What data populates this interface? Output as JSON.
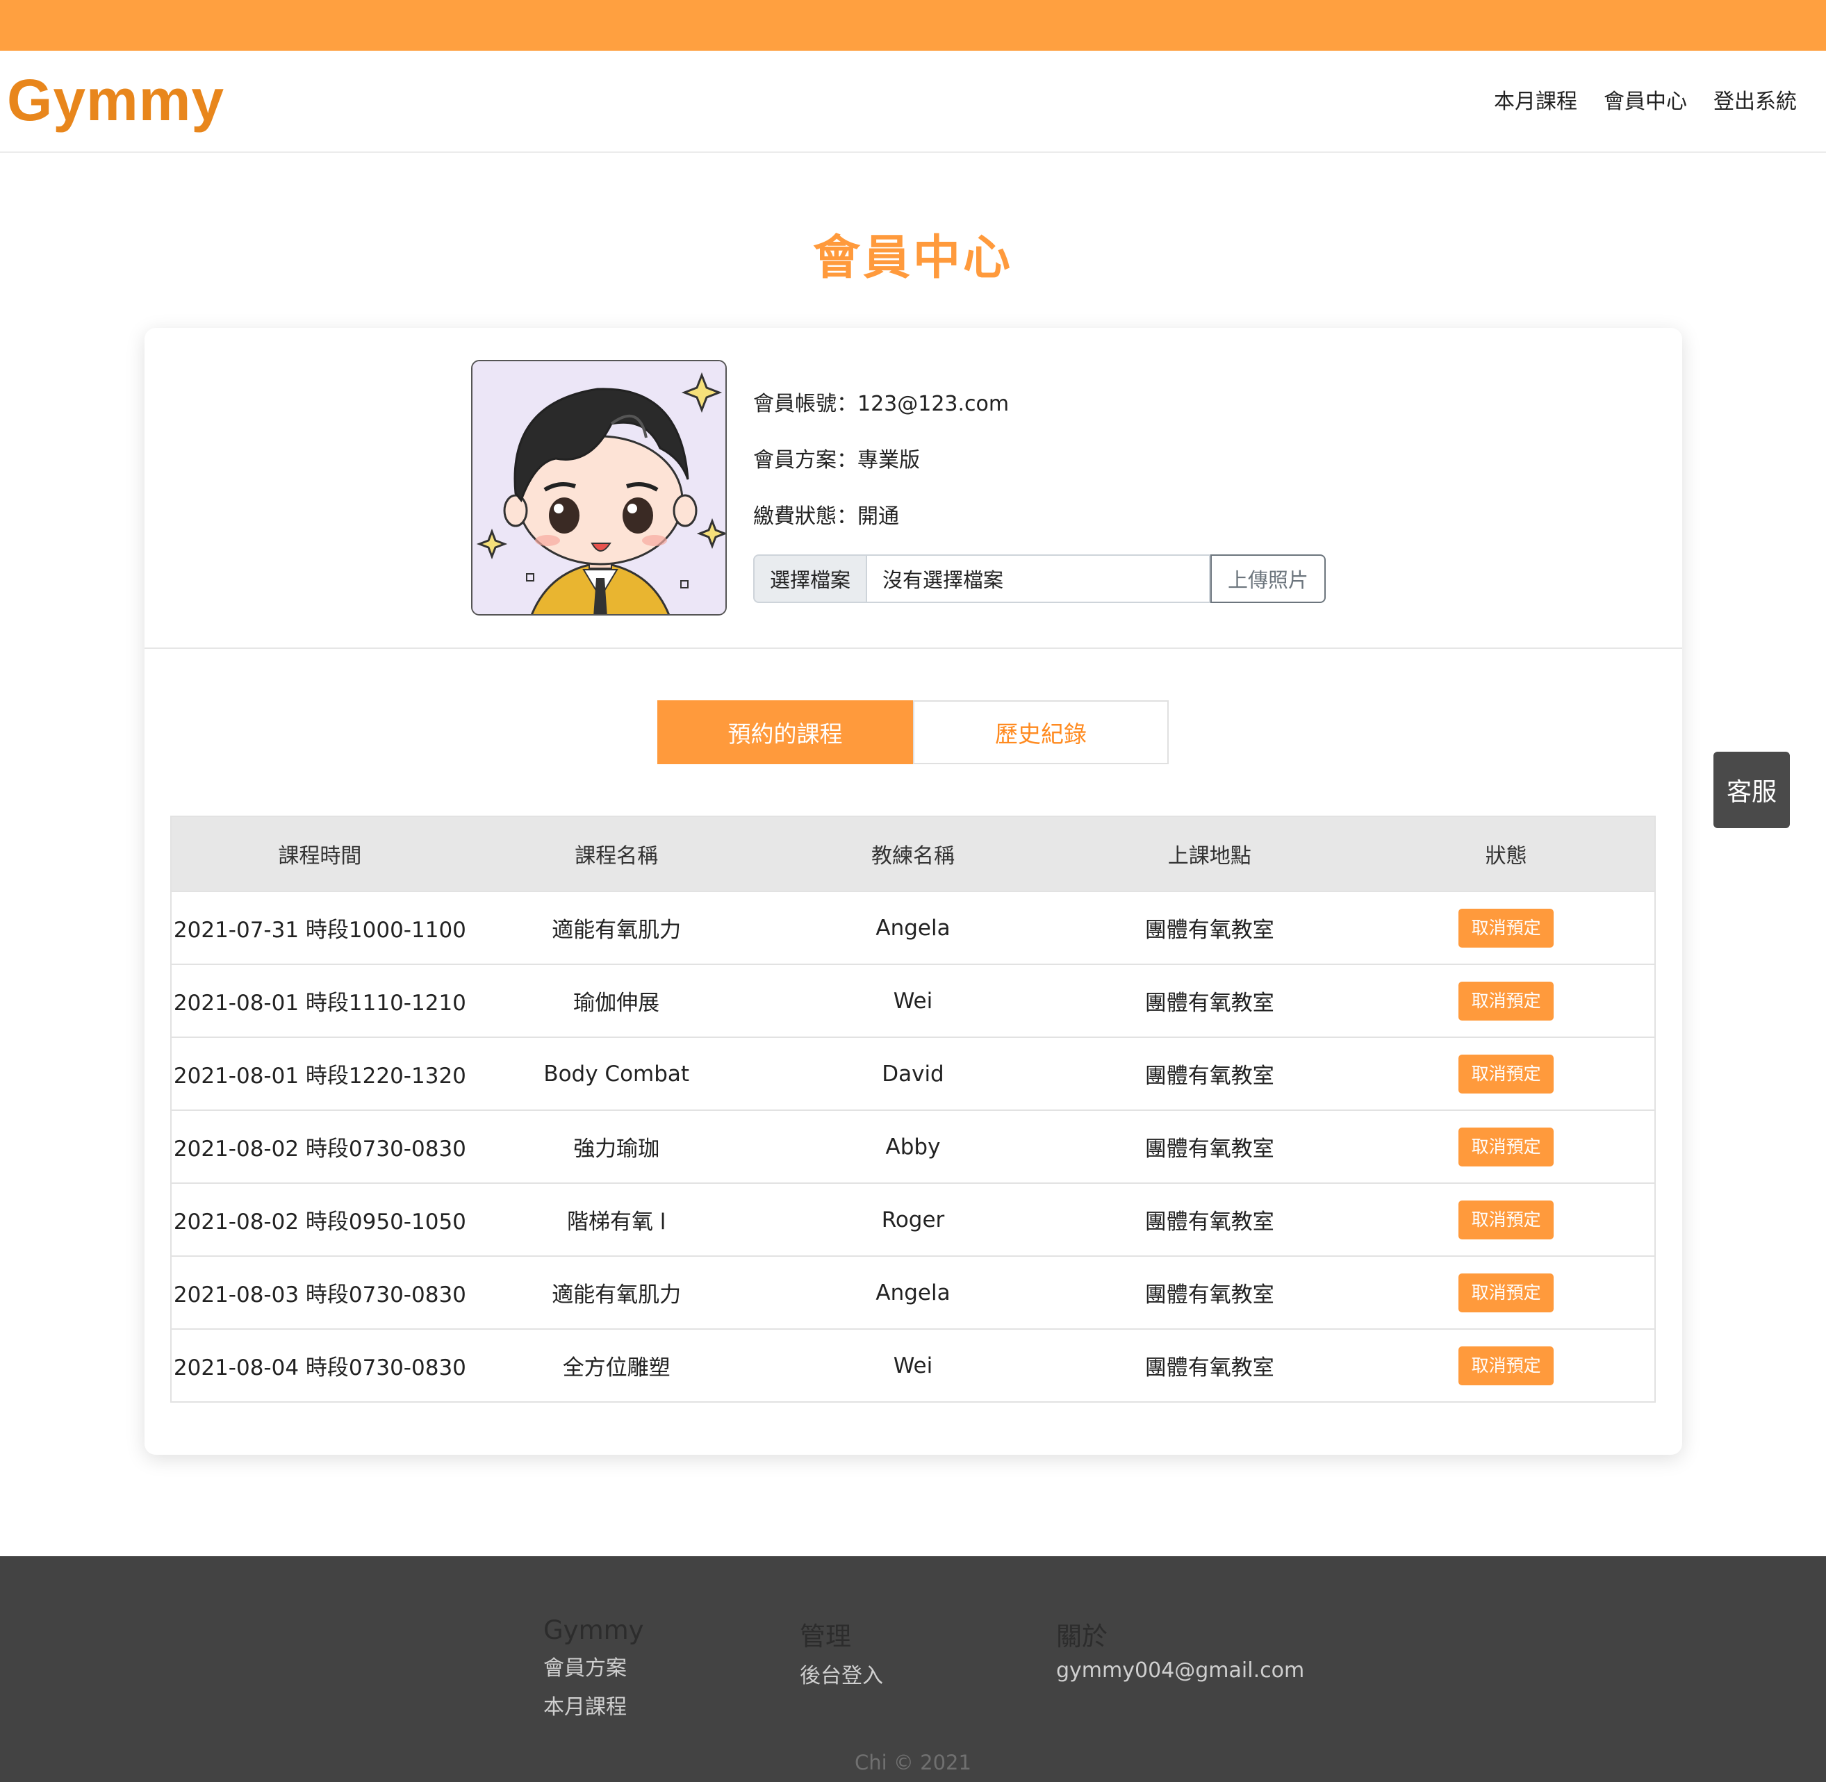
{
  "brand": "Gymmy",
  "nav": {
    "courses": "本月課程",
    "member": "會員中心",
    "logout": "登出系統"
  },
  "page_title": "會員中心",
  "profile": {
    "account_label": "會員帳號：",
    "account_value": "123@123.com",
    "plan_label": "會員方案：",
    "plan_value": "專業版",
    "payment_label": "繳費狀態：",
    "payment_value": "開通",
    "file_choose_label": "選擇檔案",
    "file_name": "沒有選擇檔案",
    "upload_label": "上傳照片"
  },
  "tabs": {
    "booked": "預約的課程",
    "history": "歷史紀錄"
  },
  "table": {
    "headers": [
      "課程時間",
      "課程名稱",
      "教練名稱",
      "上課地點",
      "狀態"
    ],
    "rows": [
      {
        "time": "2021-07-31 時段1000-1100",
        "course": "適能有氧肌力",
        "coach": "Angela",
        "location": "團體有氧教室",
        "action": "取消預定"
      },
      {
        "time": "2021-08-01 時段1110-1210",
        "course": "瑜伽伸展",
        "coach": "Wei",
        "location": "團體有氧教室",
        "action": "取消預定"
      },
      {
        "time": "2021-08-01 時段1220-1320",
        "course": "Body Combat",
        "coach": "David",
        "location": "團體有氧教室",
        "action": "取消預定"
      },
      {
        "time": "2021-08-02 時段0730-0830",
        "course": "強力瑜珈",
        "coach": "Abby",
        "location": "團體有氧教室",
        "action": "取消預定"
      },
      {
        "time": "2021-08-02 時段0950-1050",
        "course": "階梯有氧 l",
        "coach": "Roger",
        "location": "團體有氧教室",
        "action": "取消預定"
      },
      {
        "time": "2021-08-03 時段0730-0830",
        "course": "適能有氧肌力",
        "coach": "Angela",
        "location": "團體有氧教室",
        "action": "取消預定"
      },
      {
        "time": "2021-08-04 時段0730-0830",
        "course": "全方位雕塑",
        "coach": "Wei",
        "location": "團體有氧教室",
        "action": "取消預定"
      }
    ]
  },
  "service_button": "客服",
  "footer": {
    "col1_title": "Gymmy",
    "col1_links": [
      "會員方案",
      "本月課程"
    ],
    "col2_title": "管理",
    "col2_links": [
      "後台登入"
    ],
    "col3_title": "關於",
    "col3_email": "gymmy004@gmail.com",
    "copyright": "Chi © 2021"
  },
  "colors": {
    "accent": "#ff9a3c",
    "brand": "#e8861c",
    "footer_bg": "#434343"
  }
}
